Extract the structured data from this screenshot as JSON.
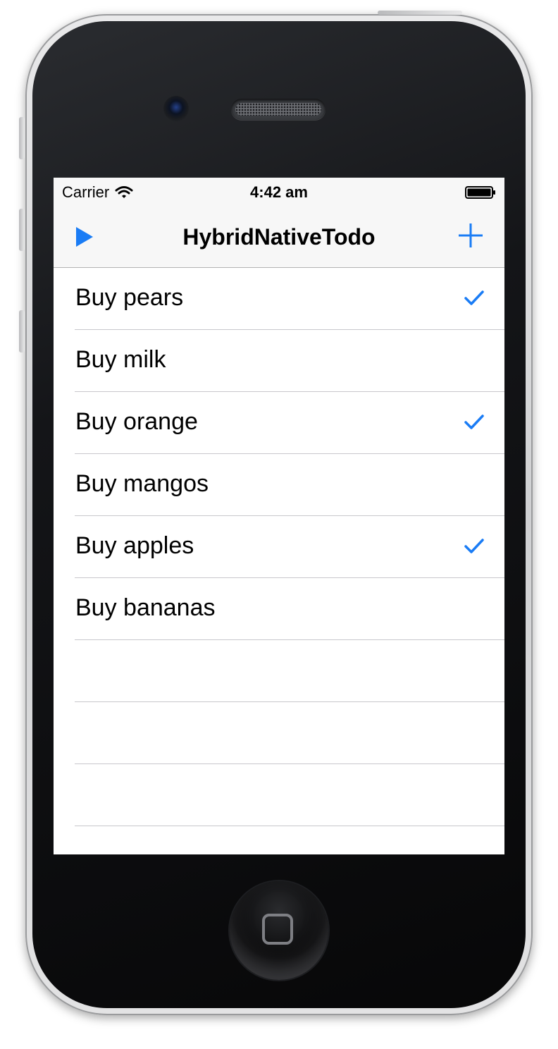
{
  "status_bar": {
    "carrier": "Carrier",
    "time": "4:42 am",
    "wifi_icon": "wifi-icon",
    "battery_icon": "battery-full-icon"
  },
  "nav_bar": {
    "title": "HybridNativeTodo",
    "left_icon": "play-icon",
    "right_icon": "plus-icon",
    "tint_color": "#1a7cf5"
  },
  "todos": [
    {
      "label": "Buy pears",
      "done": true
    },
    {
      "label": "Buy milk",
      "done": false
    },
    {
      "label": "Buy orange",
      "done": true
    },
    {
      "label": "Buy mangos",
      "done": false
    },
    {
      "label": "Buy apples",
      "done": true
    },
    {
      "label": "Buy bananas",
      "done": false
    }
  ],
  "empty_rows": 3
}
